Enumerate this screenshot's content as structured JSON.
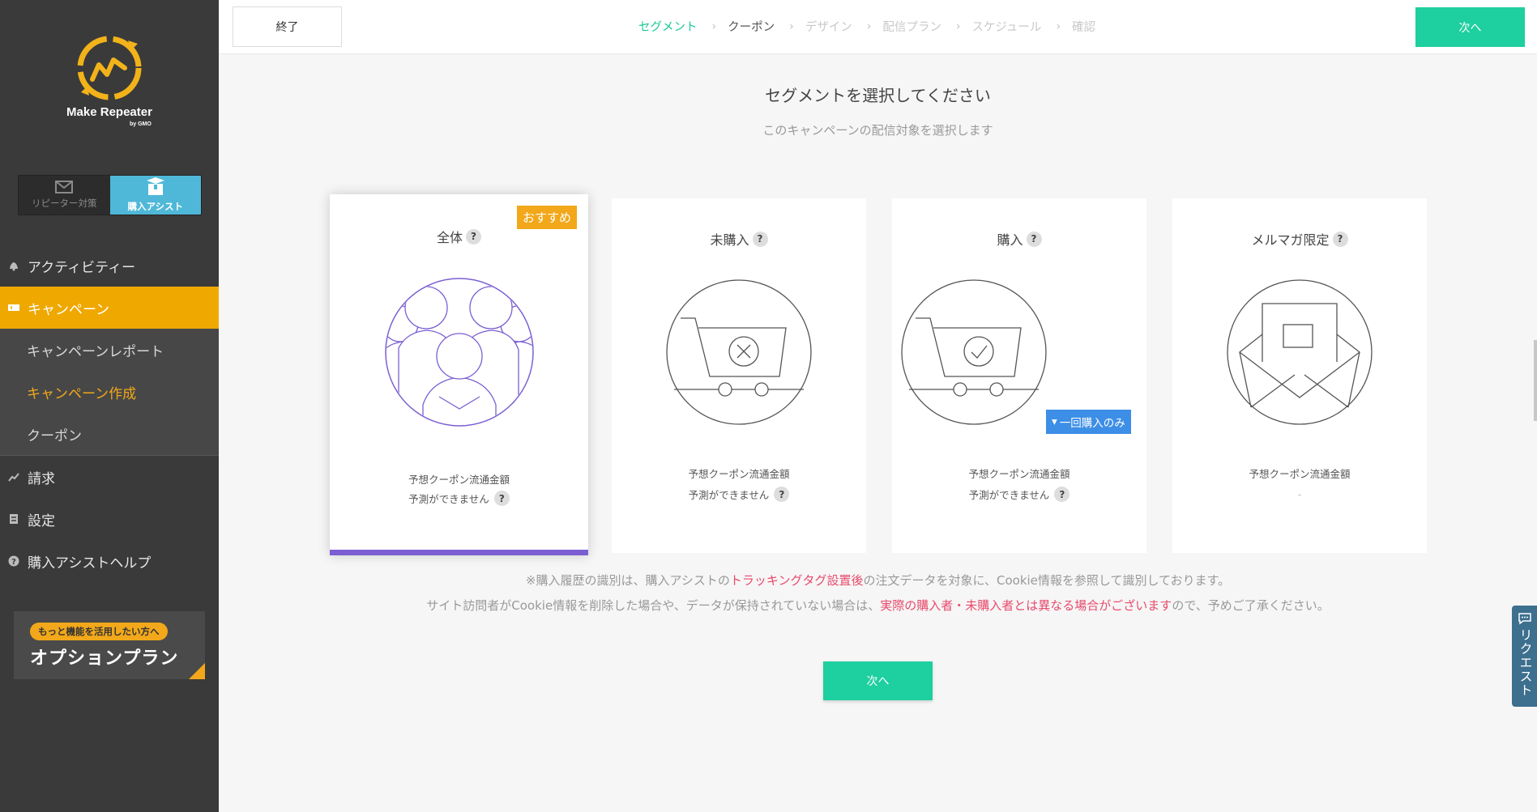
{
  "colors": {
    "accent": "#1ecf9f",
    "brand": "#efa800",
    "sidebar": "#3a3a3a",
    "highlight": "#e84a6b",
    "selected_bar": "#7b5fd2",
    "blue": "#3d8ee6"
  },
  "sidebar": {
    "logo": {
      "text": "Make Repeater",
      "by": "by GMO",
      "icon": "logo-icon"
    },
    "mode_switch": {
      "repeater": {
        "label": "リピーター対策",
        "icon": "mail-icon"
      },
      "assist": {
        "label": "購入アシスト",
        "icon": "box-icon"
      }
    },
    "nav": {
      "activity": {
        "label": "アクティビティー",
        "icon": "bell-icon"
      },
      "campaign": {
        "label": "キャンペーン",
        "icon": "ticket-icon"
      },
      "campaign_report": {
        "label": "キャンペーンレポート"
      },
      "campaign_create": {
        "label": "キャンペーン作成"
      },
      "coupon": {
        "label": "クーポン"
      },
      "billing": {
        "label": "請求",
        "icon": "chart-icon"
      },
      "settings": {
        "label": "設定",
        "icon": "settings-icon"
      },
      "help": {
        "label": "購入アシストヘルプ",
        "icon": "help-icon"
      }
    },
    "option_banner": {
      "pill": "もっと機能を活用したい方へ",
      "title": "オプションプラン"
    }
  },
  "topbar": {
    "end_label": "終了",
    "next_label": "次へ",
    "steps": [
      {
        "label": "セグメント"
      },
      {
        "label": "クーポン"
      },
      {
        "label": "デザイン"
      },
      {
        "label": "配信プラン"
      },
      {
        "label": "スケジュール"
      },
      {
        "label": "確認"
      }
    ],
    "separator": "›"
  },
  "main": {
    "heading": "セグメントを選択してください",
    "subheading": "このキャンペーンの配信対象を選択します",
    "cards": [
      {
        "title": "全体",
        "badge": "おすすめ",
        "est_label": "予想クーポン流通金額",
        "est_value": "予測ができません",
        "illustration": "people-icon"
      },
      {
        "title": "未購入",
        "est_label": "予想クーポン流通金額",
        "est_value": "予測ができません",
        "illustration": "cart-cross-icon"
      },
      {
        "title": "購入",
        "est_label": "予想クーポン流通金額",
        "est_value": "予測ができません",
        "illustration": "cart-check-icon",
        "once_button": "一回購入のみ"
      },
      {
        "title": "メルマガ限定",
        "est_label": "予想クーポン流通金額",
        "est_value": "-",
        "illustration": "envelope-icon"
      }
    ],
    "qmark": "?",
    "note1": {
      "pre": "※購入履歴の識別は、購入アシストの",
      "hl": "トラッキングタグ設置後",
      "post": "の注文データを対象に、Cookie情報を参照して識別しております。"
    },
    "note2": {
      "pre": "サイト訪問者がCookie情報を削除した場合や、データが保持されていない場合は、",
      "hl": "実際の購入者・未購入者とは異なる場合がございます",
      "post": "ので、予めご了承ください。"
    },
    "next_label": "次へ"
  },
  "request_tab": {
    "label": "リクエスト",
    "icon": "chat-icon"
  }
}
